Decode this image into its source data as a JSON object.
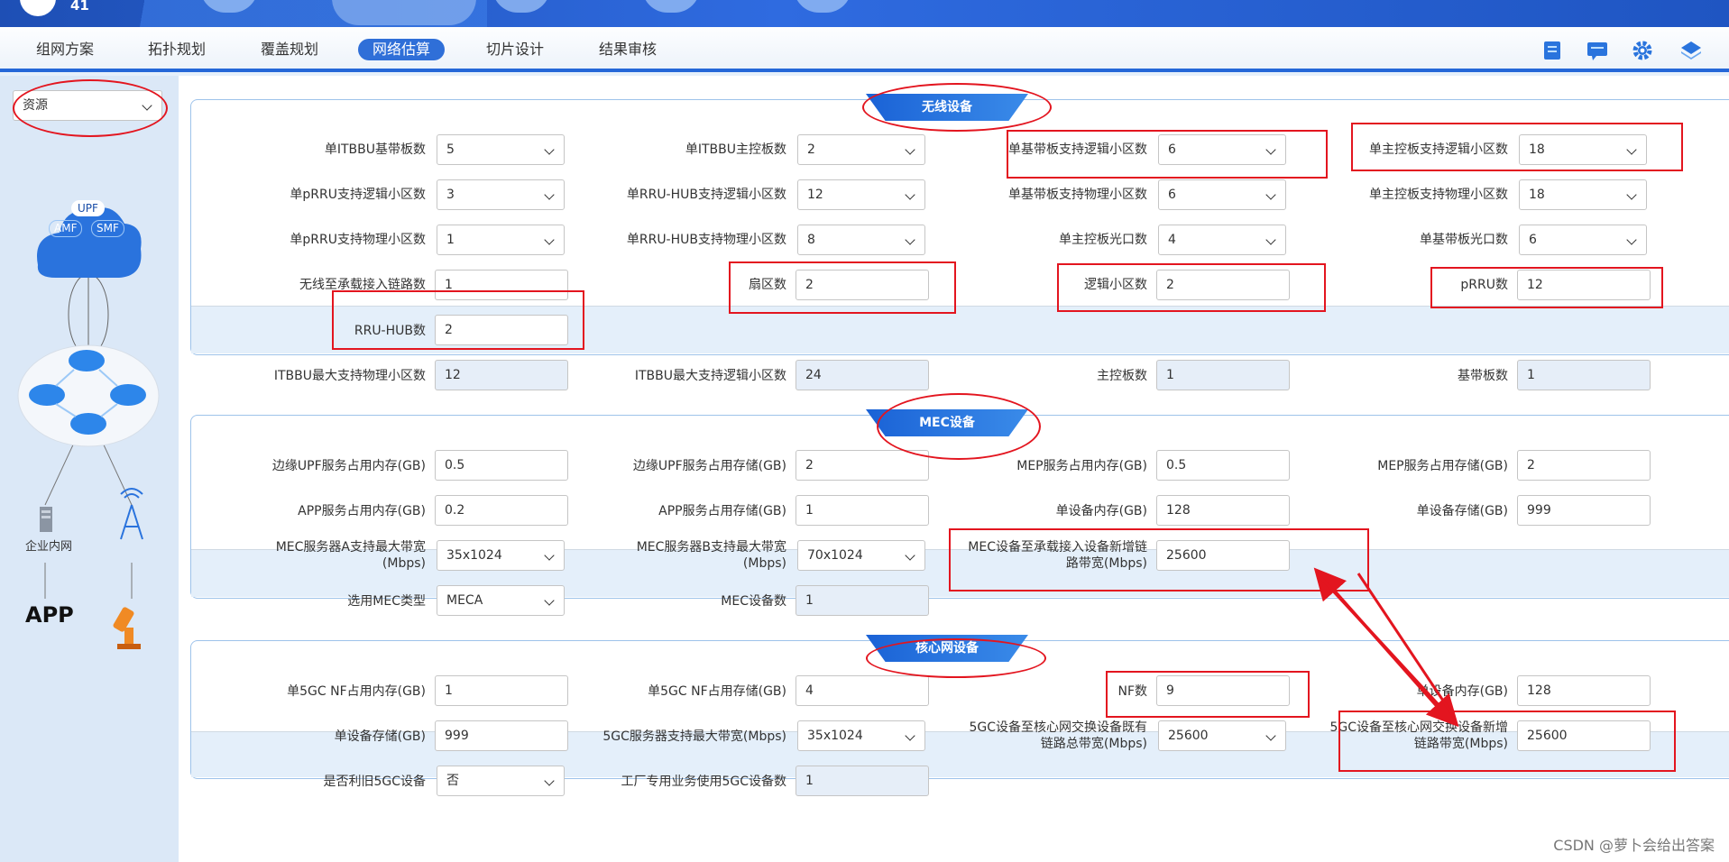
{
  "header": {
    "logo_text": "41"
  },
  "nav": {
    "tabs": [
      "组网方案",
      "拓扑规划",
      "覆盖规划",
      "网络估算",
      "切片设计",
      "结果审核"
    ],
    "active": "网络估算"
  },
  "sidebar": {
    "select_value": "资源",
    "cloud": {
      "upf": "UPF",
      "amf": "AMF",
      "smf": "SMF"
    },
    "enterprise_label": "企业内网",
    "app_label": "APP"
  },
  "wireless": {
    "title": "无线设备",
    "fields": [
      {
        "label": "单ITBBU基带板数",
        "value": "5"
      },
      {
        "label": "单ITBBU主控板数",
        "value": "2"
      },
      {
        "label": "单基带板支持逻辑小区数",
        "value": "6"
      },
      {
        "label": "单主控板支持逻辑小区数",
        "value": "18"
      },
      {
        "label": "单pRRU支持逻辑小区数",
        "value": "3"
      },
      {
        "label": "单RRU-HUB支持逻辑小区数",
        "value": "12"
      },
      {
        "label": "单基带板支持物理小区数",
        "value": "6"
      },
      {
        "label": "单主控板支持物理小区数",
        "value": "18"
      },
      {
        "label": "单pRRU支持物理小区数",
        "value": "1"
      },
      {
        "label": "单RRU-HUB支持物理小区数",
        "value": "8"
      },
      {
        "label": "单主控板光口数",
        "value": "4"
      },
      {
        "label": "单基带板光口数",
        "value": "6"
      },
      {
        "label": "无线至承载接入链路数",
        "value": "1"
      },
      {
        "label": "扇区数",
        "value": "2"
      },
      {
        "label": "逻辑小区数",
        "value": "2"
      },
      {
        "label": "pRRU数",
        "value": "12"
      },
      {
        "label": "RRU-HUB数",
        "value": "2"
      }
    ],
    "summary": [
      {
        "label": "ITBBU最大支持物理小区数",
        "value": "12"
      },
      {
        "label": "ITBBU最大支持逻辑小区数",
        "value": "24"
      },
      {
        "label": "主控板数",
        "value": "1"
      },
      {
        "label": "基带板数",
        "value": "1"
      }
    ]
  },
  "mec": {
    "title": "MEC设备",
    "fields": [
      {
        "label": "边缘UPF服务占用内存(GB)",
        "value": "0.5"
      },
      {
        "label": "边缘UPF服务占用存储(GB)",
        "value": "2"
      },
      {
        "label": "MEP服务占用内存(GB)",
        "value": "0.5"
      },
      {
        "label": "MEP服务占用存储(GB)",
        "value": "2"
      },
      {
        "label": "APP服务占用内存(GB)",
        "value": "0.2"
      },
      {
        "label": "APP服务占用存储(GB)",
        "value": "1"
      },
      {
        "label": "单设备内存(GB)",
        "value": "128"
      },
      {
        "label": "单设备存储(GB)",
        "value": "999"
      },
      {
        "label1": "MEC服务器A支持最大带宽",
        "label2": "(Mbps)",
        "value": "35x1024"
      },
      {
        "label1": "MEC服务器B支持最大带宽",
        "label2": "(Mbps)",
        "value": "70x1024"
      },
      {
        "label1": "MEC设备至承载接入设备新增链",
        "label2": "路带宽(Mbps)",
        "value": "25600"
      }
    ],
    "summary": [
      {
        "label": "选用MEC类型",
        "value": "MECA"
      },
      {
        "label": "MEC设备数",
        "value": "1"
      }
    ]
  },
  "core": {
    "title": "核心网设备",
    "fields": [
      {
        "label": "单5GC NF占用内存(GB)",
        "value": "1"
      },
      {
        "label": "单5GC NF占用存储(GB)",
        "value": "4"
      },
      {
        "label": "NF数",
        "value": "9"
      },
      {
        "label": "单设备内存(GB)",
        "value": "128"
      },
      {
        "label": "单设备存储(GB)",
        "value": "999"
      },
      {
        "label": "5GC服务器支持最大带宽(Mbps)",
        "value": "35x1024"
      },
      {
        "label1": "5GC设备至核心网交换设备既有",
        "label2": "链路总带宽(Mbps)",
        "value": "25600"
      },
      {
        "label1": "5GC设备至核心网交换设备新增",
        "label2": "链路带宽(Mbps)",
        "value": "25600"
      }
    ],
    "summary": [
      {
        "label": "是否利旧5GC设备",
        "value": "否"
      },
      {
        "label": "工厂专用业务使用5GC设备数",
        "value": "1"
      }
    ]
  },
  "watermark": "CSDN @萝卜会给出答案",
  "colors": {
    "accent": "#2f6fd8",
    "annotation": "#e3151f",
    "header": "#1e4fb5"
  }
}
